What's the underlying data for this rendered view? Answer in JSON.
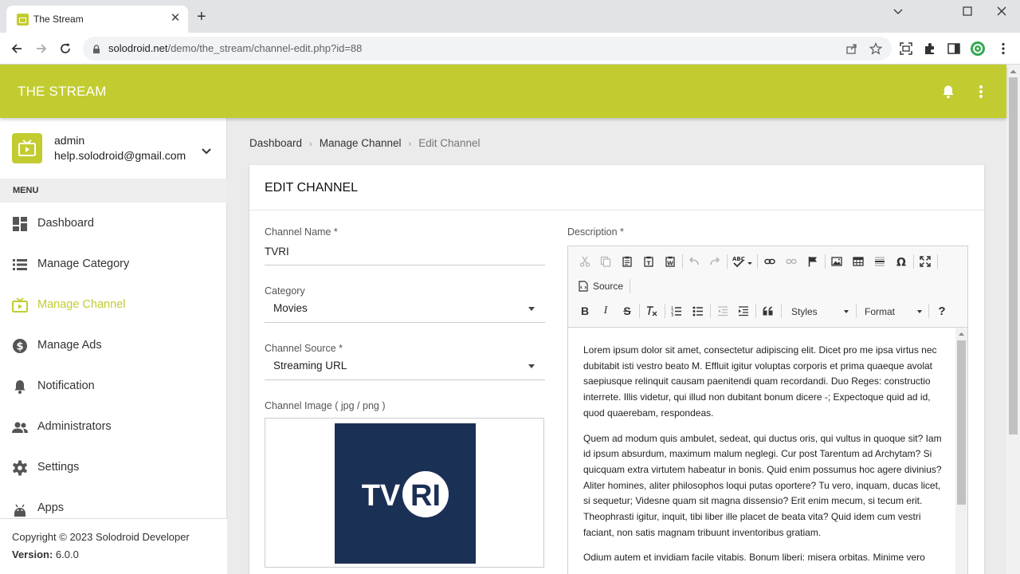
{
  "browser": {
    "tab_title": "The Stream",
    "tab_close": "✕",
    "new_tab": "+",
    "url_host": "solodroid.net",
    "url_path": "/demo/the_stream/channel-edit.php?id=88",
    "window_controls": {
      "minimize": "⌄",
      "maximize": "☐",
      "close": "✕"
    }
  },
  "header": {
    "title": "THE STREAM",
    "accent_color": "#c2cc30"
  },
  "user": {
    "name": "admin",
    "email": "help.solodroid@gmail.com"
  },
  "sidebar": {
    "menu_header": "MENU",
    "items": [
      {
        "label": "Dashboard",
        "icon": "dashboard-icon"
      },
      {
        "label": "Manage Category",
        "icon": "list-icon"
      },
      {
        "label": "Manage Channel",
        "icon": "tv-icon",
        "active": true
      },
      {
        "label": "Manage Ads",
        "icon": "dollar-icon"
      },
      {
        "label": "Notification",
        "icon": "bell-icon"
      },
      {
        "label": "Administrators",
        "icon": "people-icon"
      },
      {
        "label": "Settings",
        "icon": "gear-icon"
      },
      {
        "label": "Apps",
        "icon": "android-icon"
      }
    ],
    "copyright": "Copyright © 2023 Solodroid Developer",
    "version_label": "Version:",
    "version_value": "6.0.0"
  },
  "breadcrumb": [
    "Dashboard",
    "Manage Channel",
    "Edit Channel"
  ],
  "form": {
    "title": "EDIT CHANNEL",
    "channel_name_label": "Channel Name *",
    "channel_name_value": "TVRI",
    "category_label": "Category",
    "category_value": "Movies",
    "source_label": "Channel Source *",
    "source_value": "Streaming URL",
    "image_label": "Channel Image ( jpg / png )",
    "logo_text": "TVRI",
    "description_label": "Description *"
  },
  "editor": {
    "source_label": "Source",
    "styles_label": "Styles",
    "format_label": "Format",
    "paragraphs": [
      "Lorem ipsum dolor sit amet, consectetur adipiscing elit. Dicet pro me ipsa virtus nec dubitabit isti vestro beato M. Effluit igitur voluptas corporis et prima quaeque avolat saepiusque relinquit causam paenitendi quam recordandi. Duo Reges: constructio interrete. Illis videtur, qui illud non dubitant bonum dicere -; Expectoque quid ad id, quod quaerebam, respondeas.",
      "Quem ad modum quis ambulet, sedeat, qui ductus oris, qui vultus in quoque sit? Iam id ipsum absurdum, maximum malum neglegi. Cur post Tarentum ad Archytam? Si quicquam extra virtutem habeatur in bonis. Quid enim possumus hoc agere divinius? Aliter homines, aliter philosophos loqui putas oportere? Tu vero, inquam, ducas licet, si sequetur; Videsne quam sit magna dissensio? Erit enim mecum, si tecum erit. Theophrasti igitur, inquit, tibi liber ille placet de beata vita? Quid idem cum vestri faciant, non satis magnam tribuunt inventoribus gratiam.",
      "Odium autem et invidiam facile vitabis. Bonum liberi: misera orbitas. Minime vero"
    ]
  }
}
